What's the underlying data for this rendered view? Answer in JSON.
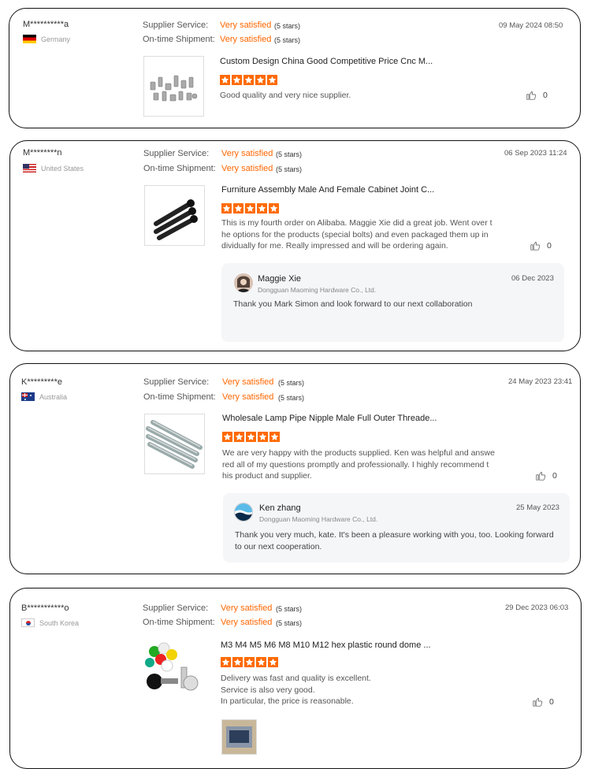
{
  "reviews": [
    {
      "user": "M**********a",
      "country": "Germany",
      "supplier_label": "Supplier Service:",
      "supplier_value": "Very satisfied",
      "supplier_stars": "(5 stars)",
      "shipment_label": "On-time Shipment:",
      "shipment_value": "Very satisfied",
      "shipment_stars": "(5 stars)",
      "date": "09 May 2024 08:50",
      "product": "Custom Design China Good Competitive Price Cnc M...",
      "rating": 5,
      "text": "Good quality and very nice supplier.",
      "likes": "0"
    },
    {
      "user": "M********n",
      "country": "United States",
      "supplier_label": "Supplier Service:",
      "supplier_value": "Very satisfied",
      "supplier_stars": "(5 stars)",
      "shipment_label": "On-time Shipment:",
      "shipment_value": "Very satisfied",
      "shipment_stars": "(5 stars)",
      "date": "06 Sep 2023 11:24",
      "product": "Furniture Assembly Male And Female Cabinet Joint C...",
      "rating": 5,
      "text_lines": [
        "This is my fourth order on Alibaba. Maggie Xie did a great job. Went over t",
        "he options for the products (special bolts) and even packaged them up in",
        "dividually for me. Really impressed and will be ordering again."
      ],
      "likes": "0",
      "reply": {
        "name": "Maggie Xie",
        "company": "Dongguan Maoming Hardware Co., Ltd.",
        "date": "06 Dec 2023",
        "text": "Thank you Mark Simon and look forward to our next collaboration"
      }
    },
    {
      "user": "K*********e",
      "country": "Australia",
      "supplier_label": "Supplier Service:",
      "supplier_value": "Very satisfied",
      "supplier_stars": "(5 stars)",
      "shipment_label": "On-time Shipment:",
      "shipment_value": "Very satisfied",
      "shipment_stars": "(5 stars)",
      "date": "24 May 2023 23:41",
      "product": "Wholesale Lamp Pipe Nipple Male Full Outer Threade...",
      "rating": 5,
      "text_lines": [
        "We are very happy with the products supplied. Ken was helpful and answe",
        "red all of my questions promptly and professionally. I highly recommend t",
        "his product and supplier."
      ],
      "likes": "0",
      "reply": {
        "name": "Ken zhang",
        "company": "Dongguan Maoming Hardware Co., Ltd.",
        "date": "25 May 2023",
        "text_lines": [
          "Thank you very much, kate. It's been a pleasure working with you, too. Looking forward",
          "to our next cooperation."
        ]
      }
    },
    {
      "user": "B***********o",
      "country": "South Korea",
      "supplier_label": "Supplier Service:",
      "supplier_value": "Very satisfied",
      "supplier_stars": "(5 stars)",
      "shipment_label": "On-time Shipment:",
      "shipment_value": "Very satisfied",
      "shipment_stars": "(5 stars)",
      "date": "29 Dec 2023 06:03",
      "product": "M3 M4 M5 M6 M8 M10 M12 hex plastic round dome ...",
      "rating": 5,
      "text_lines": [
        "Delivery was fast and quality is excellent.",
        "Service is also very good.",
        "In particular, the price is reasonable."
      ],
      "likes": "0"
    }
  ],
  "colors": {
    "accent": "#ff6600",
    "border": "#111111",
    "reply_bg": "#f5f6f8"
  },
  "icons": {
    "star": "star-icon",
    "like": "thumbs-up-icon"
  }
}
